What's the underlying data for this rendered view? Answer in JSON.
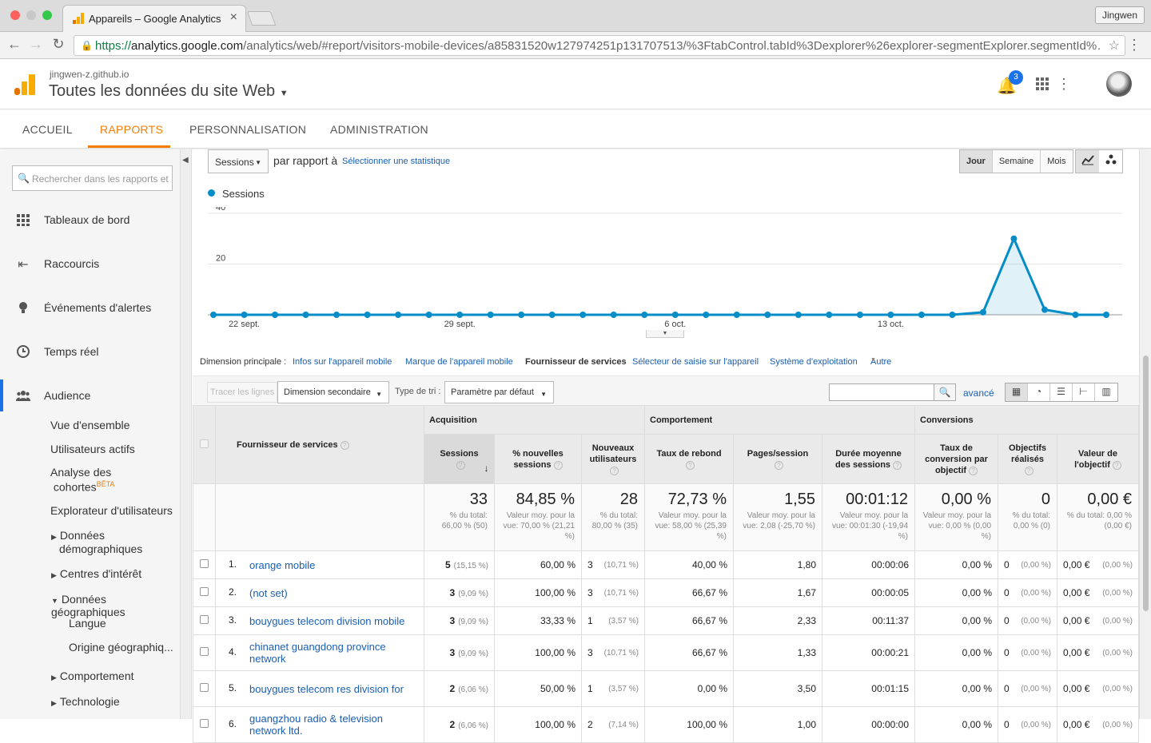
{
  "browser": {
    "tab_title": "Appareils – Google Analytics",
    "profile": "Jingwen",
    "url_protocol": "https://",
    "url_host": "analytics.google.com",
    "url_path": "/analytics/web/#report/visitors-mobile-devices/a85831520w127974251p131707513/%3FtabControl.tabId%3Dexplorer%26explorer-segmentExplorer.segmentId%…"
  },
  "ga_header": {
    "site": "jingwen-z.github.io",
    "view": "Toutes les données du site Web",
    "notifications": "3"
  },
  "nav_tabs": [
    "ACCUEIL",
    "RAPPORTS",
    "PERSONNALISATION",
    "ADMINISTRATION"
  ],
  "sidebar": {
    "search_placeholder": "Rechercher dans les rapports et l'aide",
    "items": [
      "Tableaux de bord",
      "Raccourcis",
      "Événements d'alertes",
      "Temps réel",
      "Audience"
    ],
    "audience_sub": {
      "overview": "Vue d'ensemble",
      "active_users": "Utilisateurs actifs",
      "cohorts_1": "Analyse des",
      "cohorts_2": "cohortes",
      "beta": "BÊTA",
      "explorer": "Explorateur d'utilisateurs",
      "demo_1": "Données",
      "demo_2": "démographiques",
      "interests": "Centres d'intérêt",
      "geo": "Données géographiques",
      "language": "Langue",
      "location": "Origine géographiq...",
      "behavior": "Comportement",
      "technology": "Technologie"
    }
  },
  "controls": {
    "metric": "Sessions",
    "vs": "par rapport à",
    "select_metric": "Sélectionner une statistique",
    "granularity": [
      "Jour",
      "Semaine",
      "Mois"
    ]
  },
  "chart_data": {
    "type": "area",
    "series": [
      {
        "name": "Sessions",
        "color": "#058dc7",
        "values": [
          0,
          0,
          0,
          0,
          0,
          0,
          0,
          0,
          0,
          0,
          0,
          0,
          0,
          0,
          0,
          0,
          0,
          0,
          0,
          0,
          0,
          0,
          0,
          0,
          0,
          1,
          30,
          2,
          0,
          0
        ]
      }
    ],
    "x": [
      "21 sept.",
      "22 sept.",
      "23 sept.",
      "24 sept.",
      "25 sept.",
      "26 sept.",
      "27 sept.",
      "28 sept.",
      "29 sept.",
      "30 sept.",
      "1 oct.",
      "2 oct.",
      "3 oct.",
      "4 oct.",
      "5 oct.",
      "6 oct.",
      "7 oct.",
      "8 oct.",
      "9 oct.",
      "10 oct.",
      "11 oct.",
      "12 oct.",
      "13 oct.",
      "14 oct.",
      "15 oct.",
      "16 oct.",
      "17 oct.",
      "18 oct.",
      "19 oct.",
      "20 oct."
    ],
    "x_tick_labels": [
      "22 sept.",
      "29 sept.",
      "6 oct.",
      "13 oct."
    ],
    "y_ticks": [
      "40",
      "20"
    ],
    "ylim": [
      0,
      40
    ],
    "grid": true,
    "legend": "top-left"
  },
  "dimensions": {
    "label": "Dimension principale :",
    "options": [
      "Infos sur l'appareil mobile",
      "Marque de l'appareil mobile",
      "Fournisseur de services",
      "Sélecteur de saisie sur l'appareil",
      "Système d'exploitation",
      "Autre"
    ],
    "active": "Fournisseur de services"
  },
  "table_tools": {
    "plot_rows": "Tracer les lignes",
    "secondary_dim": "Dimension secondaire",
    "sort_label": "Type de tri :",
    "sort_value": "Paramètre par défaut",
    "advanced": "avancé"
  },
  "table": {
    "groups": [
      "Acquisition",
      "Comportement",
      "Conversions"
    ],
    "columns": {
      "provider": "Fournisseur de services",
      "sessions": "Sessions",
      "new_sessions": "% nouvelles sessions",
      "new_users": "Nouveaux utilisateurs",
      "bounce": "Taux de rebond",
      "pages": "Pages/session",
      "duration": "Durée moyenne des sessions",
      "conv_rate": "Taux de conversion par objectif",
      "goals": "Objectifs réalisés",
      "goal_value": "Valeur de l'objectif"
    },
    "totals": {
      "sessions": "33",
      "sessions_sub": "% du total: 66,00 % (50)",
      "new_sessions": "84,85 %",
      "new_sessions_sub": "Valeur moy. pour la vue: 70,00 % (21,21 %)",
      "new_users": "28",
      "new_users_sub": "% du total: 80,00 % (35)",
      "bounce": "72,73 %",
      "bounce_sub": "Valeur moy. pour la vue: 58,00 % (25,39 %)",
      "pages": "1,55",
      "pages_sub": "Valeur moy. pour la vue: 2,08 (-25,70 %)",
      "duration": "00:01:12",
      "duration_sub": "Valeur moy. pour la vue: 00:01:30 (-19,94 %)",
      "conv_rate": "0,00 %",
      "conv_rate_sub": "Valeur moy. pour la vue: 0,00 % (0,00 %)",
      "goals": "0",
      "goals_sub": "% du total: 0,00 % (0)",
      "goal_value": "0,00 €",
      "goal_value_sub": "% du total: 0,00 % (0,00 €)"
    },
    "rows": [
      {
        "idx": "1.",
        "name": "orange mobile",
        "sessions": "5",
        "sessions_pct": "(15,15 %)",
        "new_sessions": "60,00 %",
        "new_users": "3",
        "new_users_pct": "(10,71 %)",
        "bounce": "40,00 %",
        "pages": "1,80",
        "duration": "00:00:06",
        "conv_rate": "0,00 %",
        "goals": "0",
        "goals_pct": "(0,00 %)",
        "goal_value": "0,00 €",
        "goal_value_pct": "(0,00 %)"
      },
      {
        "idx": "2.",
        "name": "(not set)",
        "sessions": "3",
        "sessions_pct": "(9,09 %)",
        "new_sessions": "100,00 %",
        "new_users": "3",
        "new_users_pct": "(10,71 %)",
        "bounce": "66,67 %",
        "pages": "1,67",
        "duration": "00:00:05",
        "conv_rate": "0,00 %",
        "goals": "0",
        "goals_pct": "(0,00 %)",
        "goal_value": "0,00 €",
        "goal_value_pct": "(0,00 %)"
      },
      {
        "idx": "3.",
        "name": "bouygues telecom division mobile",
        "sessions": "3",
        "sessions_pct": "(9,09 %)",
        "new_sessions": "33,33 %",
        "new_users": "1",
        "new_users_pct": "(3,57 %)",
        "bounce": "66,67 %",
        "pages": "2,33",
        "duration": "00:11:37",
        "conv_rate": "0,00 %",
        "goals": "0",
        "goals_pct": "(0,00 %)",
        "goal_value": "0,00 €",
        "goal_value_pct": "(0,00 %)"
      },
      {
        "idx": "4.",
        "name": "chinanet guangdong province network",
        "sessions": "3",
        "sessions_pct": "(9,09 %)",
        "new_sessions": "100,00 %",
        "new_users": "3",
        "new_users_pct": "(10,71 %)",
        "bounce": "66,67 %",
        "pages": "1,33",
        "duration": "00:00:21",
        "conv_rate": "0,00 %",
        "goals": "0",
        "goals_pct": "(0,00 %)",
        "goal_value": "0,00 €",
        "goal_value_pct": "(0,00 %)"
      },
      {
        "idx": "5.",
        "name": "bouygues telecom res division for",
        "sessions": "2",
        "sessions_pct": "(6,06 %)",
        "new_sessions": "50,00 %",
        "new_users": "1",
        "new_users_pct": "(3,57 %)",
        "bounce": "0,00 %",
        "pages": "3,50",
        "duration": "00:01:15",
        "conv_rate": "0,00 %",
        "goals": "0",
        "goals_pct": "(0,00 %)",
        "goal_value": "0,00 €",
        "goal_value_pct": "(0,00 %)"
      },
      {
        "idx": "6.",
        "name": "guangzhou radio & television network ltd.",
        "sessions": "2",
        "sessions_pct": "(6,06 %)",
        "new_sessions": "100,00 %",
        "new_users": "2",
        "new_users_pct": "(7,14 %)",
        "bounce": "100,00 %",
        "pages": "1,00",
        "duration": "00:00:00",
        "conv_rate": "0,00 %",
        "goals": "0",
        "goals_pct": "(0,00 %)",
        "goal_value": "0,00 €",
        "goal_value_pct": "(0,00 %)"
      }
    ]
  }
}
